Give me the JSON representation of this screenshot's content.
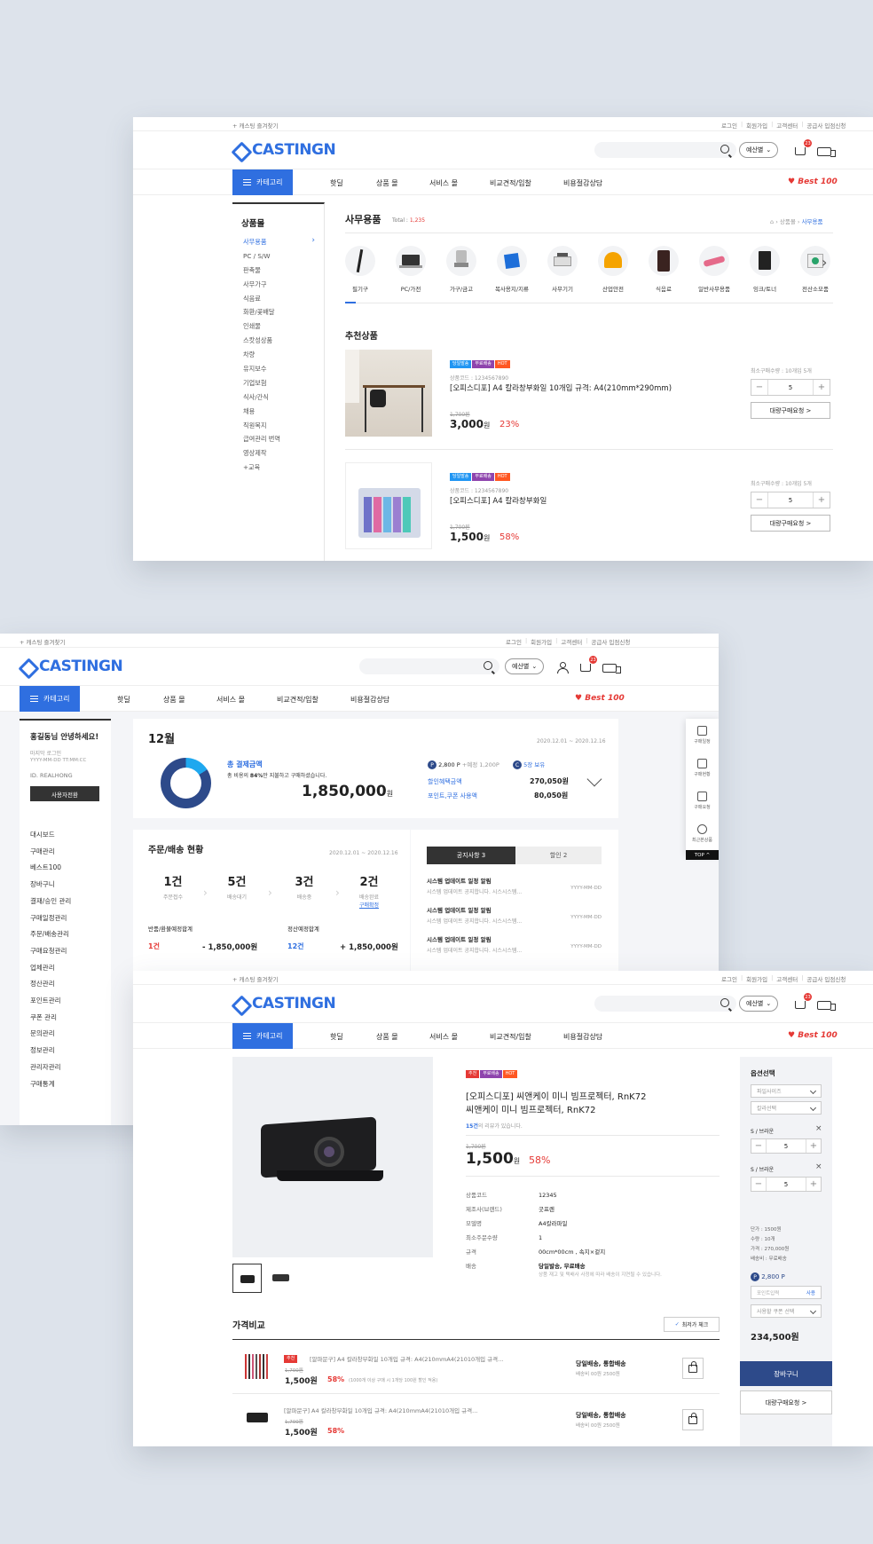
{
  "header": {
    "favorite": "+ 캐스팅 즐겨찾기",
    "login": "로그인",
    "signup": "회원가입",
    "support": "고객센터",
    "supplier": "공급사 입점신청",
    "budget": "예산별",
    "cart_count": "23",
    "logo": "CASTINGN"
  },
  "nav": {
    "category": "카테고리",
    "items": [
      "핫딜",
      "상품 몰",
      "서비스 몰",
      "비교견적/입찰",
      "비용절감상담"
    ],
    "best": "Best 100"
  },
  "win1": {
    "sidebar_title": "상품몰",
    "sidebar_items": [
      "사무용품",
      "PC / S/W",
      "판촉물",
      "사무가구",
      "식음료",
      "화환/꽃배달",
      "인쇄물",
      "스캇성상품",
      "차량",
      "유지보수",
      "기업보험",
      "식사/간식",
      "채용",
      "직원복지",
      "급여관리 번역",
      "영상제작",
      "+교육"
    ],
    "page_title": "사무용품",
    "total_label": "Total :",
    "total_value": "1,235",
    "crumb": [
      "상품몰",
      "사무용품"
    ],
    "categories": [
      "필기구",
      "PC/가전",
      "가구/금고",
      "복사용지/지류",
      "사무기기",
      "산업안전",
      "식음료",
      "일반사무용품",
      "잉크/토너",
      "전산소모품"
    ],
    "rec_title": "추천상품",
    "products": [
      {
        "tags": [
          "당일발송",
          "무료배송",
          "HOT"
        ],
        "code": "상품코드 : 1234567890",
        "name": "[오피스디포] A4 칼라창부화일 10개입 규격: A4(210mm*290mm)",
        "orig": "1,700원",
        "price": "3,000",
        "won": "원",
        "discount": "23%",
        "minqty": "최소구매수량 : 10개입 5개",
        "qty": "5",
        "bulk": "대량구매요청 >"
      },
      {
        "tags": [
          "당일발송",
          "무료배송",
          "HOT"
        ],
        "code": "상품코드 : 1234567890",
        "name": "[오피스디포] A4 칼라창부화일",
        "orig": "1,700원",
        "price": "1,500",
        "won": "원",
        "discount": "58%",
        "minqty": "최소구매수량 : 10개입 5개",
        "qty": "5",
        "bulk": "대량구매요청 >"
      }
    ]
  },
  "win2": {
    "greeting": "홍길동님 안녕하세요!",
    "last_login": "마지막 로그인",
    "last_login_time": "YYYY-MM-DD TT:MM:CC",
    "user_id": "ID. REALHONG",
    "switch_btn": "사용자전환",
    "menu": [
      "대시보드",
      "구매관리",
      "베스트100",
      "장바구니",
      "결재/승인 관리",
      "구매일정관리",
      "주문/배송관리",
      "구매요청관리",
      "업체관리",
      "정산관리",
      "포인트관리",
      "쿠폰 관리",
      "문의관리",
      "정보관리",
      "관리자관리",
      "구매통계"
    ],
    "month": "12월",
    "period": "2020.12.01 ~ 2020.12.16",
    "total_label": "총 결제금액",
    "total_desc_a": "총 비용의 ",
    "total_desc_pct": "84%",
    "total_desc_b": "만 지불하고 구매하셨습니다.",
    "total_amount": "1,850,000",
    "won": "원",
    "points": "2,800 P",
    "points_expire": "+예정 1,200P",
    "coupons": "5장 보유",
    "discount_label": "할인혜택금액",
    "discount_value": "270,050원",
    "used_label": "포인트,쿠폰 사용액",
    "used_value": "80,050원",
    "order_title": "주문/배송 현황",
    "order_period": "2020.12.01 ~ 2020.12.16",
    "stages": [
      {
        "count": "1건",
        "label": "주문접수"
      },
      {
        "count": "5건",
        "label": "배송대기"
      },
      {
        "count": "3건",
        "label": "배송중"
      },
      {
        "count": "2건",
        "label": "배송완료",
        "sub": "구매확정"
      }
    ],
    "return_label": "반품/환불예정합계",
    "return_count": "1건",
    "return_amount": "- 1,850,000원",
    "settle_label": "정산예정합계",
    "settle_count": "12건",
    "settle_amount": "+ 1,850,000원",
    "tab_notice": "공지사항 3",
    "tab_event": "할인 2",
    "notices": [
      {
        "title": "시스템 업데이트 일정 알림",
        "desc": "시스템 업데이트 공지합니다. 시스시스템...",
        "date": "YYYY-MM-DD"
      },
      {
        "title": "시스템 업데이트 일정 알림",
        "desc": "시스템 업데이트 공지합니다. 시스시스템...",
        "date": "YYYY-MM-DD"
      },
      {
        "title": "시스템 업데이트 일정 알림",
        "desc": "시스템 업데이트 공지합니다. 시스시스템...",
        "date": "YYYY-MM-DD"
      }
    ],
    "tools": [
      "구매일정",
      "구매현황",
      "구매요청",
      "최근본상품"
    ],
    "top": "TOP ^"
  },
  "win3": {
    "tags": [
      "추천",
      "무료배송",
      "HOT"
    ],
    "title1": "[오피스디포] 씨앤케이 미니 빔프로젝터, RnK72",
    "title2": "씨앤케이 미니 빔프로젝터, RnK72",
    "review_count": "15건",
    "review_text": "의 리뷰가 있습니다.",
    "orig": "1,700원",
    "price": "1,500",
    "won": "원",
    "discount": "58%",
    "specs": [
      {
        "k": "상품코드",
        "v": "12345"
      },
      {
        "k": "제조사(브랜드)",
        "v": "굿프렌"
      },
      {
        "k": "모델명",
        "v": "A4칼라파일"
      },
      {
        "k": "최소주문수량",
        "v": "1"
      },
      {
        "k": "규격",
        "v": "00cm*00cm , 속지×겉지"
      },
      {
        "k": "배송",
        "v": "당일발송, 무료배송"
      }
    ],
    "ship_note": "상품 재고 및 택배사 사정에 따라 배송이 지연될 수 있습니다.",
    "opt_title": "옵션선택",
    "opt_sel1": "파일사이즈",
    "opt_sel2": "칼라선택",
    "opts": [
      {
        "label": "S / 브라운",
        "qty": "5"
      },
      {
        "label": "S / 브라운",
        "qty": "5"
      }
    ],
    "summary": [
      "단가 : 1500원",
      "수량 : 10개",
      "가격 : 270,000원",
      "배송비 : 무료배송"
    ],
    "points": "2,800 P",
    "point_input": "포인트입력",
    "use": "사용",
    "coupon_sel": "사용할 쿠폰 선택",
    "total": "234,500원",
    "cart_btn": "장바구니",
    "bulk_btn": "대량구매요청 >",
    "compare_title": "가격비교",
    "compare_check": "최저가 체크",
    "compare": [
      {
        "tag": "추천",
        "name": "[알파문구] A4 칼라창부화일 10개입 규격: A4(210mmA4(21010개입 규격...",
        "orig": "1,700원",
        "price": "1,500원",
        "discount": "58%",
        "note": "(1000개 이상 구매 시 1개당 100원 할인 적용)",
        "ship": "당일배송, 통합배송",
        "shipfee": "배송비 00원 2500원"
      },
      {
        "tag": "",
        "name": "[알파문구] A4 칼라창부화일 10개입 규격: A4(210mmA4(21010개입 규격...",
        "orig": "1,700원",
        "price": "1,500원",
        "discount": "58%",
        "note": "",
        "ship": "당일배송, 통합배송",
        "shipfee": "배송비 00원 2500원"
      }
    ]
  }
}
